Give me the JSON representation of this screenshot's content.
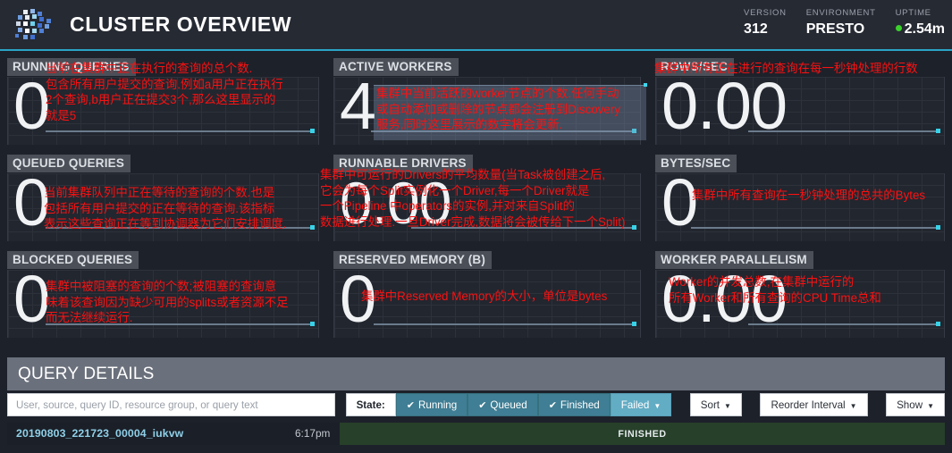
{
  "header": {
    "logo_icon": "presto-dots-logo",
    "title": "CLUSTER OVERVIEW",
    "stats": [
      {
        "label": "VERSION",
        "value": "312"
      },
      {
        "label": "ENVIRONMENT",
        "value": "PRESTO"
      },
      {
        "label": "UPTIME",
        "value": "2.54m",
        "status_color": "#3ad22b"
      }
    ]
  },
  "gauges": [
    {
      "title": "RUNNING QUERIES",
      "value": "0",
      "annotation": "当前在集群中正在执行的查询的总个数.\n包含所有用户提交的查询.例如a用户正在执行\n2个查询,b用户正在提交3个,那么这里显示的\n就是5"
    },
    {
      "title": "ACTIVE WORKERS",
      "value": "4",
      "annotation": "集群中当前活跃的worker节点的个数.任何手动\n或自动添加或删除的节点都会注册到Discovery\n服务,同时这里展示的数字将会更新."
    },
    {
      "title": "ROWS/SEC",
      "value": "0.00",
      "annotation": "集群中所有正在进行的查询在每一秒钟处理的行数"
    },
    {
      "title": "QUEUED QUERIES",
      "value": "0",
      "annotation": "当前集群队列中正在等待的查询的个数.也是\n包括所有用户提交的正在等待的查询.该指标\n表示这些查询正在等到协调器为它们安排调度."
    },
    {
      "title": "RUNNABLE DRIVERS",
      "value": "0.00",
      "annotation": "集群中可运行的Drivers的平均数量(当Task被创建之后,\n它会为每个Split实例化一个Driver,每一个Driver就是\n一个Pipeline 中operators的实例,并对来自Split的\n数据进行处理.一旦Driver完成,数据将会被传给下一个Split)"
    },
    {
      "title": "BYTES/SEC",
      "value": "0",
      "annotation": "集群中所有查询在一秒钟处理的总共的Bytes"
    },
    {
      "title": "BLOCKED QUERIES",
      "value": "0",
      "annotation": "集群中被阻塞的查询的个数;被阻塞的查询意\n味着该查询因为缺少可用的splits或者资源不足\n而无法继续运行."
    },
    {
      "title": "RESERVED MEMORY (B)",
      "value": "0",
      "annotation": "集群中Reserved Memory的大小，单位是bytes"
    },
    {
      "title": "WORKER PARALLELISM",
      "value": "0.00",
      "annotation": "Worker的并发总数,在集群中运行的\n所有Worker和所有查询的CPU Time总和"
    }
  ],
  "query_details": {
    "title": "QUERY DETAILS",
    "search_placeholder": "User, source, query ID, resource group, or query text",
    "search_value": "",
    "state_label": "State:",
    "state_filters": [
      {
        "label": "Running",
        "checked": true
      },
      {
        "label": "Queued",
        "checked": true
      },
      {
        "label": "Finished",
        "checked": true
      }
    ],
    "failed_button": "Failed",
    "sort_button": "Sort",
    "reorder_button": "Reorder Interval",
    "show_button": "Show",
    "rows": [
      {
        "query_id": "20190803_221723_00004_iukvw",
        "time": "6:17pm",
        "state": "FINISHED"
      }
    ]
  },
  "colors": {
    "accent": "#2aa5c7",
    "header_bg": "#262a33",
    "page_bg": "#1d212a",
    "annotation": "#fb1111",
    "finished_bar": "#27402a",
    "filter_on": "#3f7e94"
  }
}
